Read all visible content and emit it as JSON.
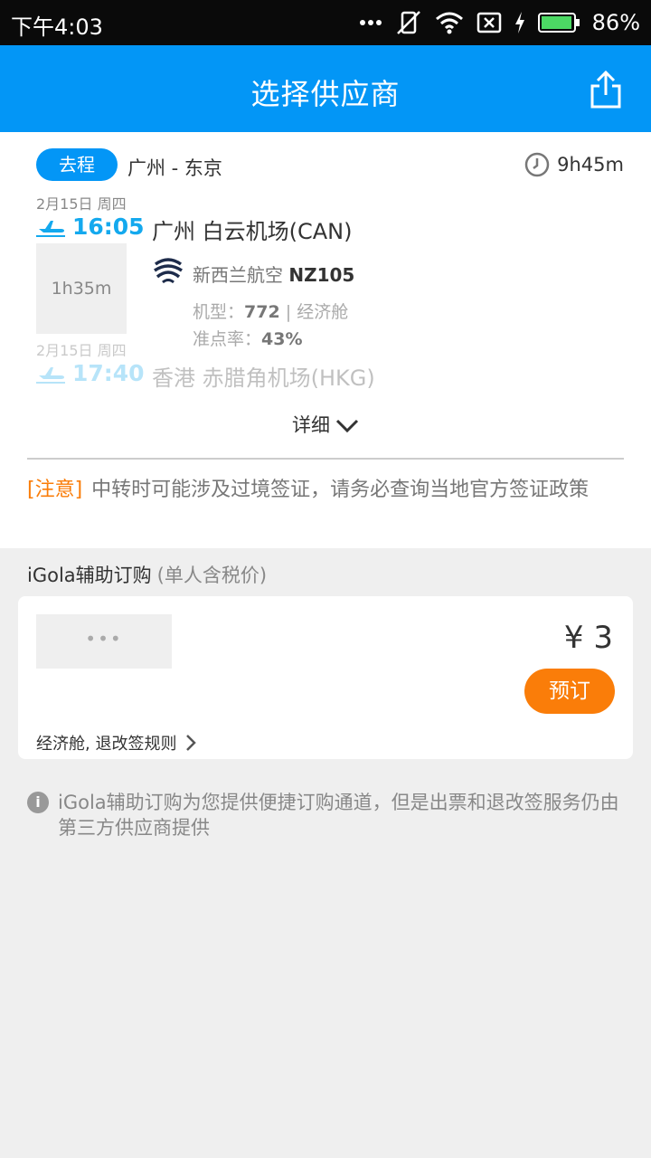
{
  "status_bar": {
    "time": "下午4:03",
    "battery_percent": "86%",
    "icons": [
      "more-dots-icon",
      "mute-icon",
      "wifi-icon",
      "no-sim-icon",
      "charging-icon",
      "battery-icon"
    ]
  },
  "header": {
    "title": "选择供应商",
    "share_icon": "share-icon"
  },
  "flight": {
    "direction_label": "去程",
    "route": "广州 - 东京",
    "total_duration": "9h45m",
    "departure": {
      "date": "2月15日 周四",
      "time": "16:05",
      "airport": "广州 白云机场(CAN)"
    },
    "segment_duration": "1h35m",
    "airline_name": "新西兰航空",
    "flight_no": "NZ105",
    "aircraft_label": "机型：",
    "aircraft": "772",
    "cabin_separator": "|",
    "cabin": "经济舱",
    "ontime_label": "准点率：",
    "ontime_rate": "43%",
    "arrival": {
      "date": "2月15日 周四",
      "time": "17:40",
      "airport": "香港 赤腊角机场(HKG)"
    },
    "detail_label": "详细"
  },
  "notice": {
    "tag": "[注意]",
    "text": "中转时可能涉及过境签证，请务必查询当地官方签证政策"
  },
  "supplier_section": {
    "title": "iGola辅助订购",
    "subtitle": "(单人含税价)"
  },
  "offer": {
    "logo_placeholder": "•••",
    "price": "¥ 3",
    "book_label": "预订",
    "rules_label": "经济舱, 退改签规则"
  },
  "info_note": {
    "icon": "info-icon",
    "text": "iGola辅助订购为您提供便捷订购通道，但是出票和退改签服务仍由第三方供应商提供"
  },
  "colors": {
    "primary": "#0396f6",
    "accent_time": "#14a9ee",
    "orange": "#fa7d09",
    "background": "#efefef"
  }
}
